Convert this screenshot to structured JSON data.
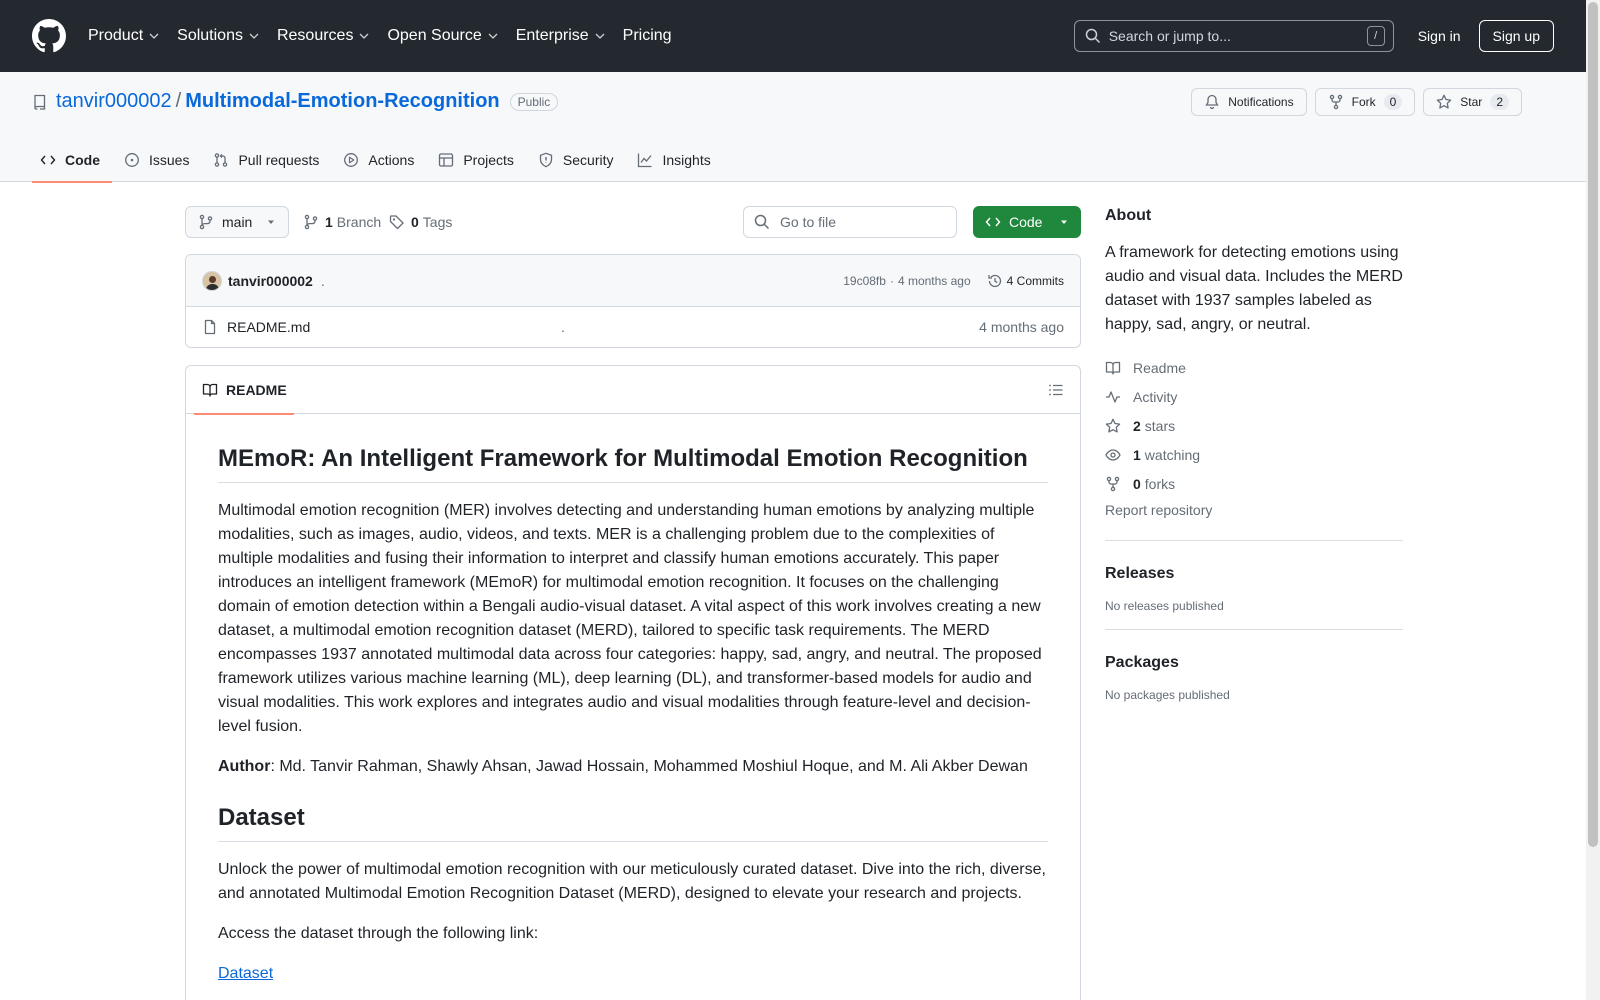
{
  "header": {
    "nav": [
      "Product",
      "Solutions",
      "Resources",
      "Open Source",
      "Enterprise",
      "Pricing"
    ],
    "search_placeholder": "Search or jump to...",
    "search_key": "/",
    "signin": "Sign in",
    "signup": "Sign up"
  },
  "repo": {
    "owner": "tanvir000002",
    "separator": "/",
    "name": "Multimodal-Emotion-Recognition",
    "visibility": "Public",
    "notifications_label": "Notifications",
    "fork_label": "Fork",
    "fork_count": "0",
    "star_label": "Star",
    "star_count": "2",
    "tabs": [
      "Code",
      "Issues",
      "Pull requests",
      "Actions",
      "Projects",
      "Security",
      "Insights"
    ]
  },
  "toolbar": {
    "branch": "main",
    "branch_count": "1",
    "branch_label": "Branch",
    "tag_count": "0",
    "tag_label": "Tags",
    "goto_placeholder": "Go to file",
    "code_label": "Code"
  },
  "commit": {
    "author": "tanvir000002",
    "message": ".",
    "hash": "19c08fb",
    "dot": "·",
    "time": "4 months ago",
    "commits": "4 Commits"
  },
  "files": [
    {
      "name": "README.md",
      "message": ".",
      "time": "4 months ago"
    }
  ],
  "readme": {
    "tab_label": "README",
    "title": "MEmoR: An Intelligent Framework for Multimodal Emotion Recognition",
    "intro": "Multimodal emotion recognition (MER) involves detecting and understanding human emotions by analyzing multiple modalities, such as images, audio, videos, and texts. MER is a challenging problem due to the complexities of multiple modalities and fusing their information to interpret and classify human emotions accurately. This paper introduces an intelligent framework (MEmoR) for multimodal emotion recognition. It focuses on the challenging domain of emotion detection within a Bengali audio-visual dataset. A vital aspect of this work involves creating a new dataset, a multimodal emotion recognition dataset (MERD), tailored to specific task requirements. The MERD encompasses 1937 annotated multimodal data across four categories: happy, sad, angry, and neutral. The proposed framework utilizes various machine learning (ML), deep learning (DL), and transformer-based models for audio and visual modalities. This work explores and integrates audio and visual modalities through feature-level and decision-level fusion.",
    "author_label": "Author",
    "authors": ": Md. Tanvir Rahman, Shawly Ahsan, Jawad Hossain, Mohammed Moshiul Hoque, and M. Ali Akber Dewan",
    "dataset_heading": "Dataset",
    "dataset_text": "Unlock the power of multimodal emotion recognition with our meticulously curated dataset. Dive into the rich, diverse, and annotated Multimodal Emotion Recognition Dataset (MERD), designed to elevate your research and projects.",
    "access_text": "Access the dataset through the following link:",
    "dataset_link": "Dataset"
  },
  "about": {
    "heading": "About",
    "description": "A framework for detecting emotions using audio and visual data. Includes the MERD dataset with 1937 samples labeled as happy, sad, angry, or neutral.",
    "readme": "Readme",
    "activity": "Activity",
    "stars_count": "2",
    "stars_label": "stars",
    "watching_count": "1",
    "watching_label": "watching",
    "forks_count": "0",
    "forks_label": "forks",
    "report": "Report repository"
  },
  "releases": {
    "heading": "Releases",
    "text": "No releases published"
  },
  "packages": {
    "heading": "Packages",
    "text": "No packages published"
  },
  "colors": {
    "header_bg": "#24292f",
    "link": "#0969da",
    "primary_button": "#1f883d",
    "tab_underline": "#fd8c73"
  }
}
